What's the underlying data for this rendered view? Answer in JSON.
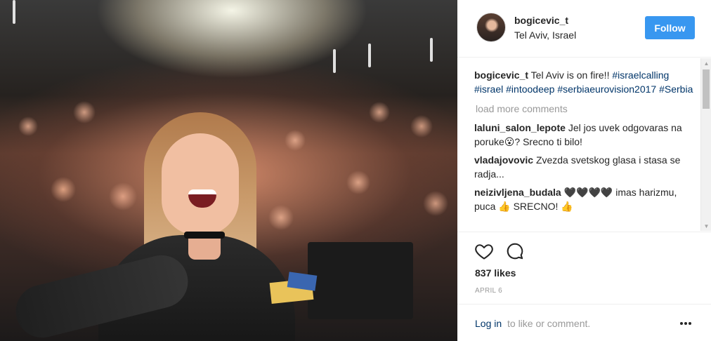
{
  "header": {
    "username": "bogicevic_t",
    "location": "Tel Aviv, Israel",
    "follow_label": "Follow"
  },
  "caption": {
    "username": "bogicevic_t",
    "text": "Tel Aviv is on fire!!",
    "hashtags": [
      "#israelcalling",
      "#israel",
      "#intoodeep",
      "#serbiaeurovision2017",
      "#Serbia"
    ]
  },
  "load_more_label": "load more comments",
  "comments": [
    {
      "username": "laluni_salon_lepote",
      "text": "Jel jos uvek odgovaras na poruke😮? Srecno ti bilo!"
    },
    {
      "username": "vladajovovic",
      "text": "Zvezda svetskog glasa i stasa se radja..."
    },
    {
      "username": "neizivljena_budala",
      "text": "🖤🖤🖤🖤 imas harizmu, puca 👍 SRECNO! 👍"
    }
  ],
  "actions": {
    "like_icon": "heart-icon",
    "comment_icon": "comment-icon"
  },
  "likes": "837 likes",
  "date": "APRIL 6",
  "footer": {
    "login_link": "Log in",
    "login_rest": "to like or comment.",
    "more_icon": "more-options-icon"
  },
  "colors": {
    "follow_button": "#3897f0",
    "link": "#003569",
    "muted": "#999999"
  }
}
